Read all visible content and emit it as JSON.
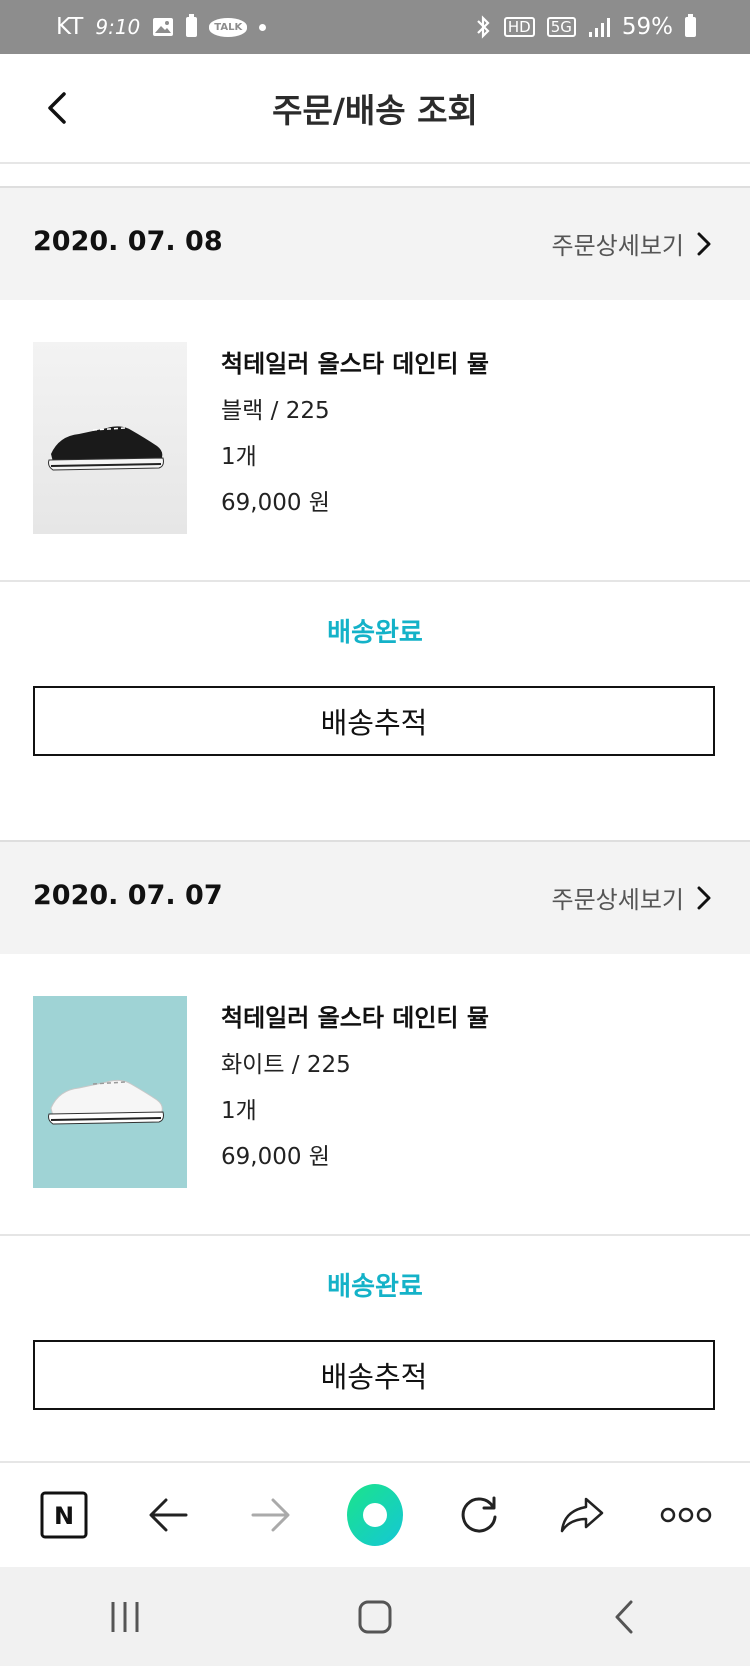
{
  "status_bar": {
    "carrier": "KT",
    "time": "9:10",
    "network_badges": [
      "HD",
      "5G"
    ],
    "battery": "59%"
  },
  "header": {
    "title": "주문/배송 조회"
  },
  "orders": [
    {
      "date": "2020. 07. 08",
      "detail_link": "주문상세보기",
      "item": {
        "name": "척테일러 올스타 데인티 뮬",
        "option": "블랙 / 225",
        "quantity": "1개",
        "price": "69,000 원"
      },
      "status": "배송완료",
      "track_button": "배송추적"
    },
    {
      "date": "2020. 07. 07",
      "detail_link": "주문상세보기",
      "item": {
        "name": "척테일러 올스타 데인티 뮬",
        "option": "화이트 / 225",
        "quantity": "1개",
        "price": "69,000 원"
      },
      "status": "배송완료",
      "track_button": "배송추적"
    }
  ],
  "colors": {
    "accent": "#14b2c8",
    "date_bar": "#f3f3f3",
    "status_bar": "#8d8d8d"
  },
  "browser_toolbar": {
    "n_logo_label": "N"
  }
}
